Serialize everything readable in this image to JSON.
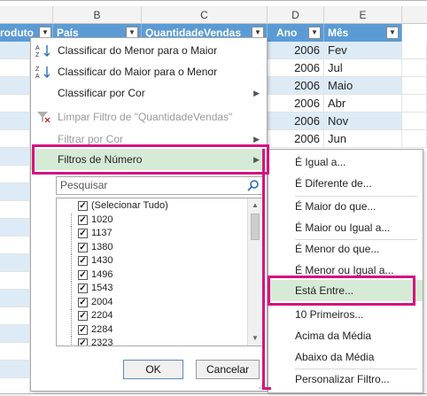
{
  "columns": {
    "b": "B",
    "c": "C",
    "d": "D",
    "e": "E"
  },
  "table_header": {
    "produto": "roduto",
    "pais": "País",
    "quantidade": "QuantidadeVendas",
    "ano": "Ano",
    "mes": "Mês"
  },
  "rows": [
    {
      "ano": "2006",
      "mes": "Fev"
    },
    {
      "ano": "2006",
      "mes": "Jul"
    },
    {
      "ano": "2006",
      "mes": "Maio"
    },
    {
      "ano": "2006",
      "mes": "Abr"
    },
    {
      "ano": "2006",
      "mes": "Nov"
    },
    {
      "ano": "2006",
      "mes": "Jun"
    }
  ],
  "menu": {
    "sort_asc": "Classificar do Menor para o Maior",
    "sort_desc": "Classificar do Maior para o Menor",
    "sort_color": "Classificar por Cor",
    "clear_filter": "Limpar Filtro de \"QuantidadeVendas\"",
    "filter_color": "Filtrar por Cor",
    "number_filters": "Filtros de Número",
    "search_placeholder": "Pesquisar",
    "ok": "OK",
    "cancel": "Cancelar"
  },
  "values_list": [
    "(Selecionar Tudo)",
    "1020",
    "1137",
    "1380",
    "1430",
    "1496",
    "1543",
    "2004",
    "2204",
    "2284",
    "2323"
  ],
  "submenu": {
    "equals": "É Igual a...",
    "not_equals": "É Diferente de...",
    "greater": "É Maior do que...",
    "greater_equal": "É Maior ou Igual a...",
    "less": "É Menor do que...",
    "less_equal": "É Menor ou Igual a...",
    "between": "Está Entre...",
    "top10": "10 Primeiros...",
    "above_avg": "Acima da Média",
    "below_avg": "Abaixo da Média",
    "custom": "Personalizar Filtro..."
  },
  "colors": {
    "table_header": "#5b9bd5",
    "band": "#ddebf7",
    "highlight": "#d6ebd6",
    "callout": "#d6147f"
  }
}
